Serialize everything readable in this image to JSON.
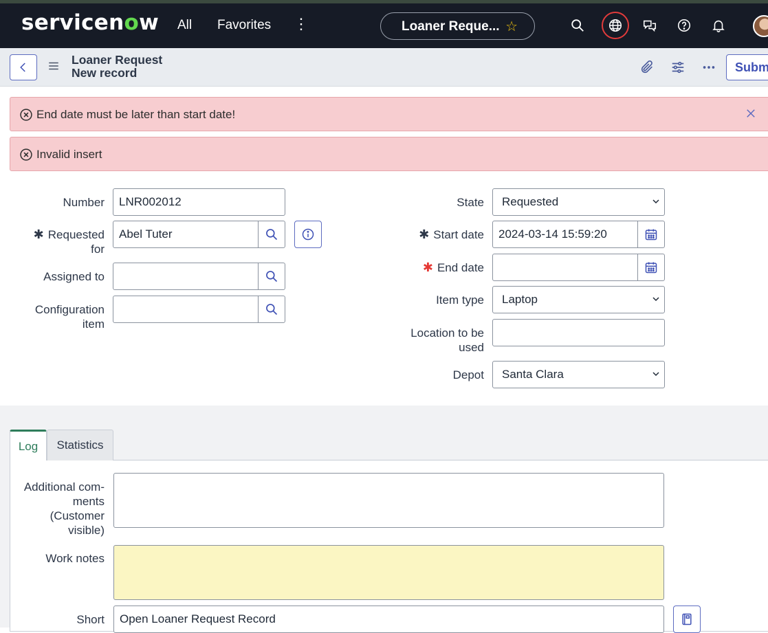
{
  "nav": {
    "logo_text_prefix": "servicen",
    "logo_text_o": "o",
    "logo_text_suffix": "w",
    "all": "All",
    "favorites": "Favorites",
    "pill_title": "Loaner Reque...",
    "icons": [
      "search-icon",
      "globe-icon",
      "chat-icon",
      "help-icon",
      "bell-icon"
    ]
  },
  "record": {
    "title": "Loaner Request",
    "subtitle": "New record",
    "submit_label": "Submi"
  },
  "alerts": [
    {
      "message": "End date must be later than start date!"
    },
    {
      "message": "Invalid insert"
    }
  ],
  "form": {
    "left": {
      "number_label": "Number",
      "number_value": "LNR002012",
      "requested_for_label_1": "Requested",
      "requested_for_label_2": "for",
      "requested_for_value": "Abel Tuter",
      "assigned_to_label": "Assigned to",
      "assigned_to_value": "",
      "config_item_label_1": "Configuration",
      "config_item_label_2": "item",
      "config_item_value": ""
    },
    "right": {
      "state_label": "State",
      "state_value": "Requested",
      "start_date_label": "Start date",
      "start_date_value": "2024-03-14 15:59:20",
      "end_date_label": "End date",
      "end_date_value": "",
      "item_type_label": "Item type",
      "item_type_value": "Laptop",
      "location_label_1": "Location to be",
      "location_label_2": "used",
      "location_value": "",
      "depot_label": "Depot",
      "depot_value": "Santa Clara"
    }
  },
  "tabs": [
    {
      "label": "Log",
      "active": true
    },
    {
      "label": "Statistics",
      "active": false
    }
  ],
  "log": {
    "additional_comments_label_1": "Additional com-",
    "additional_comments_label_2": "ments",
    "additional_comments_label_3": "(Customer",
    "additional_comments_label_4": "visible)",
    "work_notes_label": "Work notes",
    "short_label": "Short",
    "short_value": "Open Loaner Request Record"
  },
  "colors": {
    "navbar": "#161b26",
    "accent": "#3f51b5",
    "alert_bg": "#f7cdd0",
    "required_red": "#e53935",
    "work_notes_bg": "#fbf6c3",
    "tab_active": "#2e7d5b"
  }
}
